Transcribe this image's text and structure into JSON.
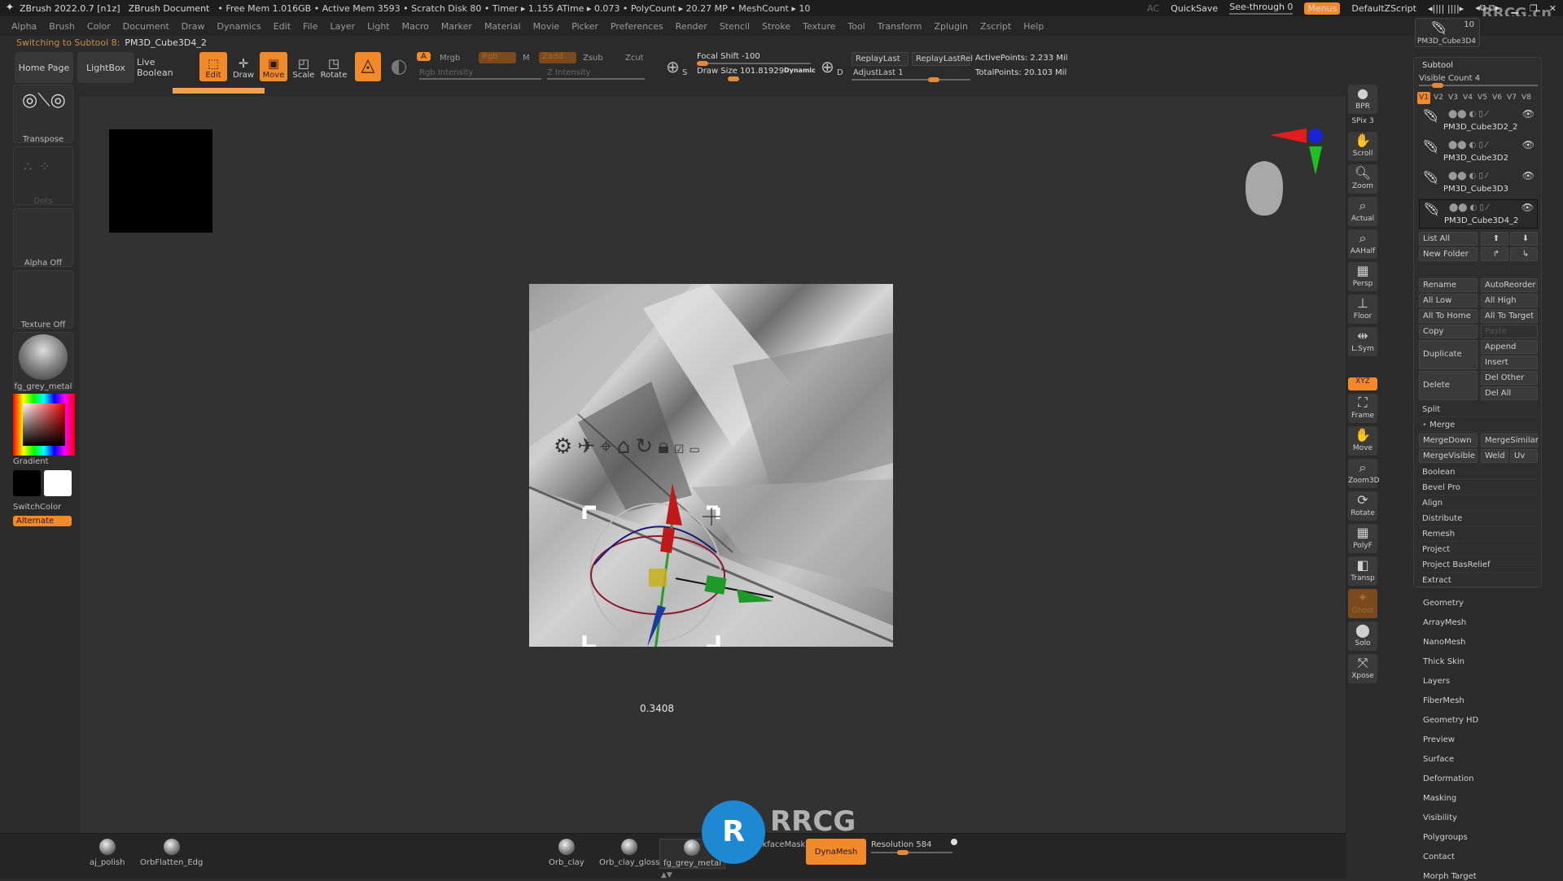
{
  "titlebar": {
    "app": "ZBrush 2022.0.7 [n1z]",
    "document": "ZBrush Document",
    "stats": "• Free Mem 1.016GB • Active Mem 3593 • Scratch Disk 80 •  Timer ▸ 1.155 ATime ▸ 0.073 • PolyCount ▸ 20.27 MP  • MeshCount ▸ 10",
    "right": [
      "AC",
      "QuickSave",
      "See-through  0",
      "Menus",
      "DefaultZScript"
    ],
    "watermark": "RRCG.cn"
  },
  "menubar": [
    "Alpha",
    "Brush",
    "Color",
    "Document",
    "Draw",
    "Dynamics",
    "Edit",
    "File",
    "Layer",
    "Light",
    "Macro",
    "Marker",
    "Material",
    "Movie",
    "Picker",
    "Preferences",
    "Render",
    "Stencil",
    "Stroke",
    "Texture",
    "Tool",
    "Transform",
    "Zplugin",
    "Zscript",
    "Help"
  ],
  "status": {
    "label": "Switching to Subtool 8:",
    "value": "PM3D_Cube3D4_2"
  },
  "toolbar": {
    "home": "Home Page",
    "lightbox": "LightBox",
    "live_boolean": "Live Boolean",
    "edit": "Edit",
    "draw": "Draw",
    "move": "Move",
    "scale": "Scale",
    "rotate": "Rotate",
    "a": "A",
    "mrgb": "Mrgb",
    "rgb": "Rgb",
    "m": "M",
    "zadd": "Zadd",
    "zsub": "Zsub",
    "zcut": "Zcut",
    "rgb_intensity": "Rgb Intensity",
    "z_intensity": "Z Intensity",
    "focal_shift": "Focal Shift -100",
    "draw_size": "Draw Size  101.81929",
    "dynamic": "Dynamic",
    "replay_last": "ReplayLast",
    "replay_last_rel": "ReplayLastRel",
    "adjust_last": "AdjustLast  1",
    "active_points": "ActivePoints: 2.233 Mil",
    "total_points": "TotalPoints: 20.103 Mil",
    "s": "S",
    "d": "D"
  },
  "leftbar": {
    "transpose": "Transpose",
    "dots": "Dots",
    "alpha": "Alpha Off",
    "texture": "Texture Off",
    "material": "fg_grey_metal",
    "gradient": "Gradient",
    "switchcolor": "SwitchColor",
    "alternate": "Alternate"
  },
  "viewport": {
    "readout": "0.3408"
  },
  "rightshelf": [
    "BPR",
    "SPix 3",
    "Scroll",
    "Zoom",
    "Actual",
    "AAHalf",
    "Persp",
    "Floor",
    "L.Sym",
    "XYZ",
    "Frame",
    "Move",
    "Zoom3D",
    "Rotate",
    "PolyF",
    "Transp",
    "Ghost",
    "Solo",
    "Xpose"
  ],
  "tool_thumb": {
    "name": "PM3D_Cube3D4",
    "count": "10"
  },
  "subtool": {
    "title": "Subtool",
    "visible_count": "Visible Count 4",
    "visibility_sets": [
      "V1",
      "V2",
      "V3",
      "V4",
      "V5",
      "V6",
      "V7",
      "V8"
    ],
    "items": [
      "PM3D_Cube3D2_2",
      "PM3D_Cube3D2",
      "PM3D_Cube3D3",
      "PM3D_Cube3D4_2"
    ],
    "buttons": {
      "list_all": "List All",
      "new_folder": "New Folder",
      "rename": "Rename",
      "autoreorder": "AutoReorder",
      "all_low": "All Low",
      "all_high": "All High",
      "all_to_home": "All To Home",
      "all_to_target": "All To Target",
      "copy": "Copy",
      "paste": "Paste",
      "duplicate": "Duplicate",
      "append": "Append",
      "insert": "Insert",
      "delete": "Delete",
      "del_other": "Del Other",
      "del_all": "Del All",
      "split": "Split",
      "merge": "Merge",
      "mergedown": "MergeDown",
      "mergesimilar": "MergeSimilar",
      "mergevisible": "MergeVisible",
      "weld": "Weld",
      "uv": "Uv"
    },
    "sections": [
      "Boolean",
      "Bevel Pro",
      "Align",
      "Distribute",
      "Remesh",
      "Project",
      "Project BasRelief",
      "Extract"
    ]
  },
  "tool_sections": [
    "Geometry",
    "ArrayMesh",
    "NanoMesh",
    "Thick Skin",
    "Layers",
    "FiberMesh",
    "Geometry HD",
    "Preview",
    "Surface",
    "Deformation",
    "Masking",
    "Visibility",
    "Polygroups",
    "Contact",
    "Morph Target"
  ],
  "bottombar": {
    "materials": [
      "aj_polish",
      "OrbFlatten_Edg",
      "Orb_clay",
      "Orb_clay_gloss",
      "fg_grey_metal"
    ],
    "backface": "BackfaceMask",
    "dynamesh": "DynaMesh",
    "resolution": "Resolution  584"
  },
  "colors": {
    "accent": "#f08a2b",
    "bg": "#2b2b2b",
    "panel": "#2e2e2e"
  }
}
